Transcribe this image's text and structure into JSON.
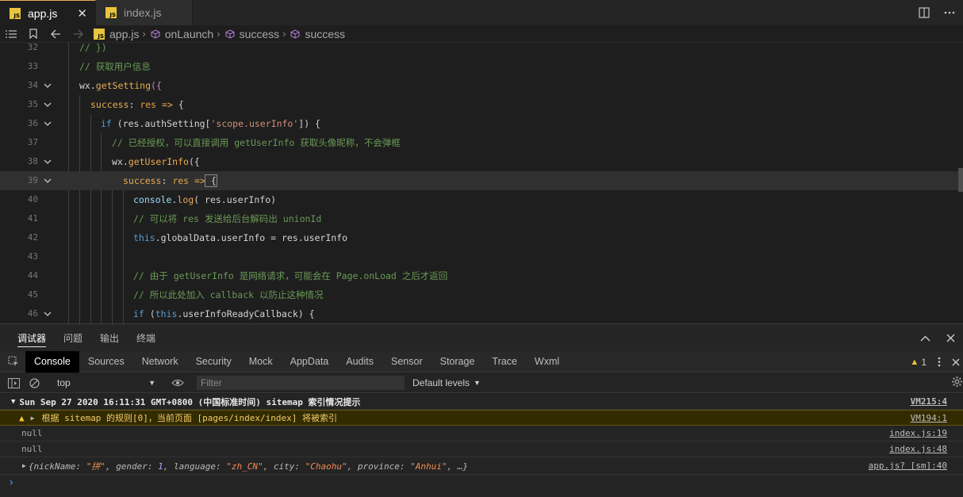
{
  "tabs": [
    {
      "badge": "JS",
      "label": "app.js",
      "close": "✕"
    },
    {
      "badge": "JS",
      "label": "index.js"
    }
  ],
  "breadcrumb": {
    "file": "app.js",
    "items": [
      "onLaunch",
      "success",
      "success"
    ]
  },
  "colors": {
    "accent": "#e8ab53",
    "comment": "#6a9955",
    "string": "#ce9178",
    "warning_bg": "#332b00",
    "link": "#4e9ef5"
  },
  "editor": {
    "lines": [
      {
        "n": "32",
        "tokens": [
          {
            "c": "c-cmt",
            "t": "// })"
          }
        ]
      },
      {
        "n": "33",
        "tokens": [
          {
            "c": "c-cmt",
            "t": "// 获取用户信息"
          }
        ]
      },
      {
        "n": "34",
        "tokens": [
          {
            "c": "c-wx",
            "t": "wx."
          },
          {
            "c": "c-method",
            "t": "getSetting"
          },
          {
            "c": "c-kw",
            "t": "({"
          }
        ]
      },
      {
        "n": "35",
        "tokens": [
          {
            "c": "c-key",
            "t": "success"
          },
          {
            "c": "c-p",
            "t": ": "
          },
          {
            "c": "c-orange",
            "t": "res"
          },
          {
            "c": "c-p",
            "t": " "
          },
          {
            "c": "c-key",
            "t": "=>"
          },
          {
            "c": "c-p",
            "t": " {"
          }
        ]
      },
      {
        "n": "36",
        "tokens": [
          {
            "c": "c-this",
            "t": "if"
          },
          {
            "c": "c-p",
            "t": " (res.authSetting["
          },
          {
            "c": "c-str",
            "t": "'scope.userInfo'"
          },
          {
            "c": "c-p",
            "t": "]) {"
          }
        ]
      },
      {
        "n": "37",
        "tokens": [
          {
            "c": "c-cmt",
            "t": "// 已经授权，可以直接调用 getUserInfo 获取头像昵称，不会弹框"
          }
        ]
      },
      {
        "n": "38",
        "tokens": [
          {
            "c": "c-wx",
            "t": "wx."
          },
          {
            "c": "c-method",
            "t": "getUserInfo"
          },
          {
            "c": "c-p",
            "t": "({"
          }
        ]
      },
      {
        "n": "39",
        "tokens": [
          {
            "c": "c-key",
            "t": "success"
          },
          {
            "c": "c-p",
            "t": ": "
          },
          {
            "c": "c-orange",
            "t": "res"
          },
          {
            "c": "c-p",
            "t": " "
          },
          {
            "c": "c-key",
            "t": "=>"
          },
          {
            "c": "c-p",
            "t": " {"
          }
        ]
      },
      {
        "n": "40",
        "tokens": [
          {
            "c": "c-var",
            "t": "console"
          },
          {
            "c": "c-p",
            "t": "."
          },
          {
            "c": "c-method",
            "t": "log"
          },
          {
            "c": "c-p",
            "t": "( res.userInfo)"
          }
        ]
      },
      {
        "n": "41",
        "tokens": [
          {
            "c": "c-cmt",
            "t": "// 可以将 res 发送给后台解码出 unionId"
          }
        ]
      },
      {
        "n": "42",
        "tokens": [
          {
            "c": "c-this",
            "t": "this"
          },
          {
            "c": "c-p",
            "t": ".globalData.userInfo = res.userInfo"
          }
        ]
      },
      {
        "n": "43",
        "tokens": []
      },
      {
        "n": "44",
        "tokens": [
          {
            "c": "c-cmt",
            "t": "// 由于 getUserInfo 是网络请求，可能会在 Page.onLoad 之后才返回"
          }
        ]
      },
      {
        "n": "45",
        "tokens": [
          {
            "c": "c-cmt",
            "t": "// 所以此处加入 callback 以防止这种情况"
          }
        ]
      },
      {
        "n": "46",
        "tokens": [
          {
            "c": "c-this",
            "t": "if"
          },
          {
            "c": "c-p",
            "t": " ("
          },
          {
            "c": "c-this",
            "t": "this"
          },
          {
            "c": "c-p",
            "t": ".userInfoReadyCallback) {"
          }
        ]
      }
    ]
  },
  "panel": {
    "tabs": [
      "调试器",
      "问题",
      "输出",
      "终端"
    ]
  },
  "devtools": {
    "tabs": [
      "Console",
      "Sources",
      "Network",
      "Security",
      "Mock",
      "AppData",
      "Audits",
      "Sensor",
      "Storage",
      "Trace",
      "Wxml"
    ],
    "warning_count": "1"
  },
  "console_toolbar": {
    "context": "top",
    "filter_placeholder": "Filter",
    "levels": "Default levels"
  },
  "console": {
    "group": {
      "text": "Sun Sep 27 2020 16:11:31 GMT+0800 (中国标准时间) sitemap 索引情况提示",
      "source": "VM215:4"
    },
    "warning": {
      "text": "根据 sitemap 的规则[0]，当前页面 [pages/index/index] 将被索引",
      "source": "VM194:1"
    },
    "logs": [
      {
        "text": "null",
        "source": "index.js:19"
      },
      {
        "text": "null",
        "source": "index.js:48"
      }
    ],
    "object": {
      "fields": [
        {
          "k": "nickName",
          "v": "\"拼\"",
          "t": "str"
        },
        {
          "k": "gender",
          "v": "1",
          "t": "num"
        },
        {
          "k": "language",
          "v": "\"zh_CN\"",
          "t": "str"
        },
        {
          "k": "city",
          "v": "\"Chaohu\"",
          "t": "str"
        },
        {
          "k": "province",
          "v": "\"Anhui\"",
          "t": "str"
        }
      ],
      "ellipsis": "…",
      "source": "app.js? [sm]:40"
    },
    "prompt": "›"
  }
}
